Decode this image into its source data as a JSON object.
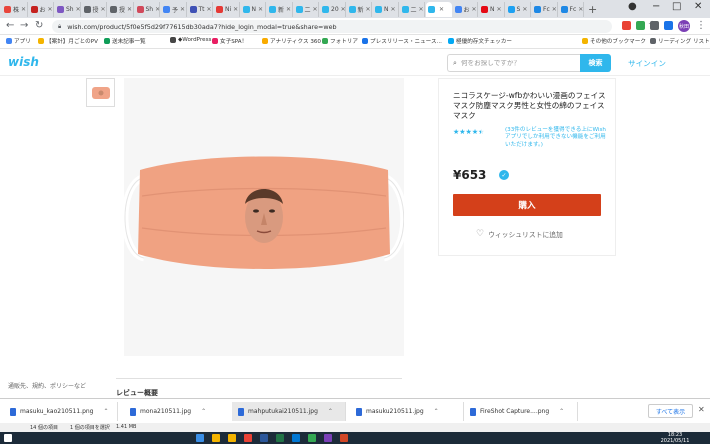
{
  "browser": {
    "tabs": [
      {
        "label": "株",
        "color": "#e8453c"
      },
      {
        "label": "お",
        "color": "#c5221f"
      },
      {
        "label": "Sh",
        "color": "#7e57c2"
      },
      {
        "label": "授",
        "color": "#5f6368"
      },
      {
        "label": "授",
        "color": "#5f6368"
      },
      {
        "label": "Sh",
        "color": "#d1495b"
      },
      {
        "label": "予",
        "color": "#4285f4"
      },
      {
        "label": "Tt",
        "color": "#3f51b5"
      },
      {
        "label": "Ni",
        "color": "#e53935"
      },
      {
        "label": "N",
        "color": "#2fb7ec"
      },
      {
        "label": "新",
        "color": "#2fb7ec"
      },
      {
        "label": "二",
        "color": "#2fb7ec"
      },
      {
        "label": "20",
        "color": "#2fb7ec"
      },
      {
        "label": "新",
        "color": "#2fb7ec"
      },
      {
        "label": "N",
        "color": "#2fb7ec"
      },
      {
        "label": "二",
        "color": "#2fb7ec"
      },
      {
        "label": "",
        "color": "#2fb7ec"
      },
      {
        "label": "お",
        "color": "#4285f4"
      },
      {
        "label": "N",
        "color": "#e50914"
      },
      {
        "label": "S",
        "color": "#1da1f2"
      },
      {
        "label": "Fc",
        "color": "#1e88e5"
      },
      {
        "label": "Fc",
        "color": "#1e88e5"
      }
    ],
    "url": "wish.com/product/5f0e5f5d29f77615db30ada7?hide_login_modal=true&share=web",
    "profile_initials": "秋田",
    "bookmarks": [
      {
        "label": "アプリ",
        "color": "#4285f4"
      },
      {
        "label": "【案計】月ごとのPV",
        "color": "#f4b400"
      },
      {
        "label": "送未記事一覧",
        "color": "#0f9d58"
      },
      {
        "label": "◆WordPress",
        "color": "#464646"
      },
      {
        "label": "女子SPA！",
        "color": "#e91e63"
      },
      {
        "label": "アナリティクス 360",
        "color": "#f9ab00"
      },
      {
        "label": "フォトリア",
        "color": "#34a853"
      },
      {
        "label": "プレスリリース・ニュース...",
        "color": "#1a73e8"
      },
      {
        "label": "極優的存文チェッカー",
        "color": "#03a9f4"
      },
      {
        "label": "その他のブックマーク",
        "color": "#f4b400"
      },
      {
        "label": "リーディング リスト",
        "color": "#5f6368"
      }
    ]
  },
  "site": {
    "logo": "wish",
    "search_placeholder": "何をお探しですか？",
    "search_button": "検索",
    "signin": "サインイン"
  },
  "product": {
    "title": "ニコラスケージ-wfbかわいい漫画のフェイスマスク防塵マスク男性と女性の綿のフェイスマスク",
    "stars": "★★★★★",
    "rating_fraction": 0.9,
    "review_text": "(33件のレビューを獲得できる上にWishアプリでしか利用できない機能をご利用いただけます。)",
    "price": "¥653",
    "buy_button": "購入",
    "wishlist": "ウィッシュリストに追加"
  },
  "page": {
    "footer_link": "通販先、規約、ポリシーなど",
    "section_title": "レビュー概要"
  },
  "downloads": {
    "items": [
      {
        "name": "masuku_kao210511.png"
      },
      {
        "name": "mona210511.jpg"
      },
      {
        "name": "mahputukai210511.jpg"
      },
      {
        "name": "masuku210511.jpg"
      },
      {
        "name": "FireShot Capture....png"
      }
    ],
    "show_all": "すべて表示"
  },
  "explorer": {
    "items_count": "14 個の項目",
    "selected": "1 個の項目を選択",
    "size": "1.41 MB"
  },
  "taskbar": {
    "time": "18:23",
    "date": "2021/05/11"
  }
}
